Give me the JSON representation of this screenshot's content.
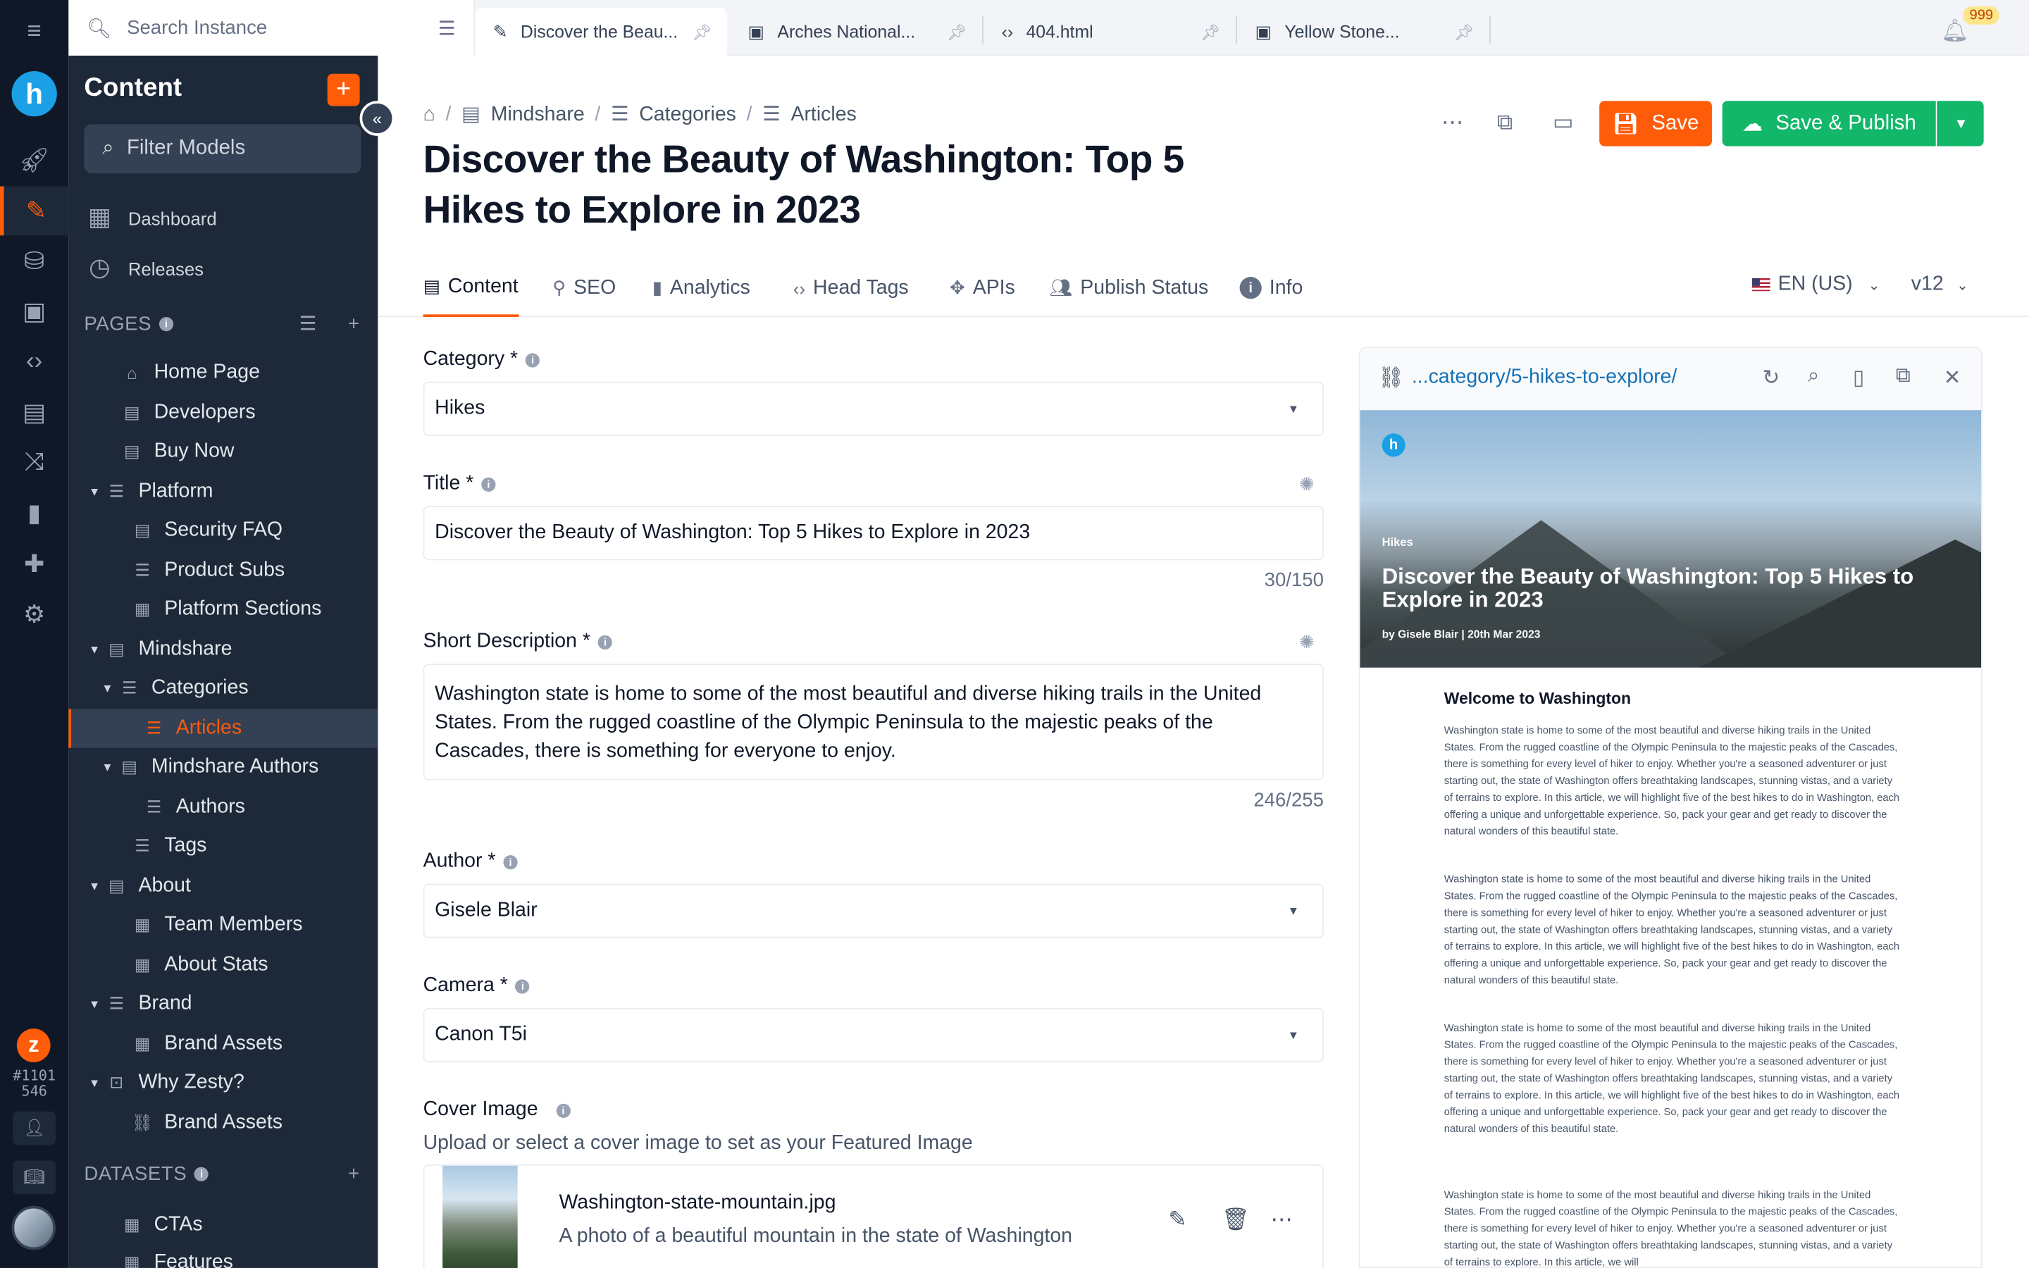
{
  "search": {
    "placeholder": "Search Instance"
  },
  "tabs": [
    {
      "label": "Discover the Beau...",
      "icon": "pencil-icon"
    },
    {
      "label": "Arches National...",
      "icon": "image-icon"
    },
    {
      "label": "404.html",
      "icon": "code-icon"
    },
    {
      "label": "Yellow Stone...",
      "icon": "image-icon"
    }
  ],
  "notifications": {
    "count": "999"
  },
  "instance": {
    "id_line1": "#1101",
    "id_line2": "546"
  },
  "sidebar": {
    "title": "Content",
    "filter_label": "Filter Models",
    "dashboard": "Dashboard",
    "releases": "Releases",
    "pages_header": "PAGES",
    "datasets_header": "DATASETS",
    "tree": [
      {
        "label": "Home Page"
      },
      {
        "label": "Developers"
      },
      {
        "label": "Buy Now"
      },
      {
        "label": "Platform"
      },
      {
        "label": "Security FAQ"
      },
      {
        "label": "Product Subs"
      },
      {
        "label": "Platform Sections"
      },
      {
        "label": "Mindshare"
      },
      {
        "label": "Categories"
      },
      {
        "label": "Articles"
      },
      {
        "label": "Mindshare Authors"
      },
      {
        "label": "Authors"
      },
      {
        "label": "Tags"
      },
      {
        "label": "About"
      },
      {
        "label": "Team Members"
      },
      {
        "label": "About Stats"
      },
      {
        "label": "Brand"
      },
      {
        "label": "Brand Assets"
      },
      {
        "label": "Why Zesty?"
      },
      {
        "label": "Brand Assets"
      }
    ],
    "datasets": [
      {
        "label": "CTAs"
      },
      {
        "label": "Features"
      }
    ]
  },
  "breadcrumb": {
    "item1": "Mindshare",
    "item2": "Categories",
    "item3": "Articles"
  },
  "page": {
    "title": "Discover the Beauty of Washington: Top 5 Hikes to Explore in 2023"
  },
  "actions": {
    "save": "Save",
    "publish": "Save & Publish"
  },
  "subtabs": {
    "content": "Content",
    "seo": "SEO",
    "analytics": "Analytics",
    "head_tags": "Head Tags",
    "apis": "APIs",
    "publish_status": "Publish Status",
    "info": "Info"
  },
  "lang": "EN (US)",
  "version": "v12",
  "form": {
    "category_label": "Category *",
    "category_value": "Hikes",
    "title_label": "Title *",
    "title_value": "Discover the Beauty of Washington: Top 5 Hikes to Explore in 2023",
    "title_count": "30/150",
    "desc_label": "Short Description *",
    "desc_value": "Washington state is home to some of the most beautiful and diverse hiking trails in the United States. From the rugged coastline of the Olympic Peninsula to the majestic peaks of the Cascades, there is something for everyone to enjoy.",
    "desc_count": "246/255",
    "author_label": "Author *",
    "author_value": "Gisele Blair",
    "camera_label": "Camera *",
    "camera_value": "Canon T5i",
    "cover_label": "Cover Image",
    "cover_helper": "Upload or select a cover image to set as your Featured Image",
    "cover_file": "Washington-state-mountain.jpg",
    "cover_desc": "A photo of a beautiful mountain in the state of Washington"
  },
  "preview": {
    "url": "...category/5-hikes-to-explore/",
    "hero_category": "Hikes",
    "hero_title": "Discover the Beauty of Washington: Top 5 Hikes to Explore in 2023",
    "hero_byline": "by Gisele Blair | 20th Mar 2023",
    "heading": "Welcome to Washington",
    "paragraph": "Washington state is home to some of the most beautiful and diverse hiking trails in the United States. From the rugged coastline of the Olympic Peninsula to the majestic peaks of the Cascades, there is something for every level of hiker to enjoy. Whether you're a seasoned adventurer or just starting out, the state of Washington offers breathtaking landscapes, stunning vistas, and a variety of terrains to explore. In this article, we will highlight five of the best hikes to do in Washington, each offering a unique and unforgettable experience. So, pack your gear and get ready to discover the natural wonders of this beautiful state.",
    "paragraph_last": "Washington state is home to some of the most beautiful and diverse hiking trails in the United States. From the rugged coastline of the Olympic Peninsula to the majestic peaks of the Cascades, there is something for every level of hiker to enjoy. Whether you're a seasoned adventurer or just starting out, the state of Washington offers breathtaking landscapes, stunning vistas, and a variety of terrains to explore. In this article, we will"
  },
  "colors": {
    "accent": "#ff5c0a",
    "publish": "#12b76a",
    "sidebar": "#1d2939",
    "rail": "#101828"
  }
}
